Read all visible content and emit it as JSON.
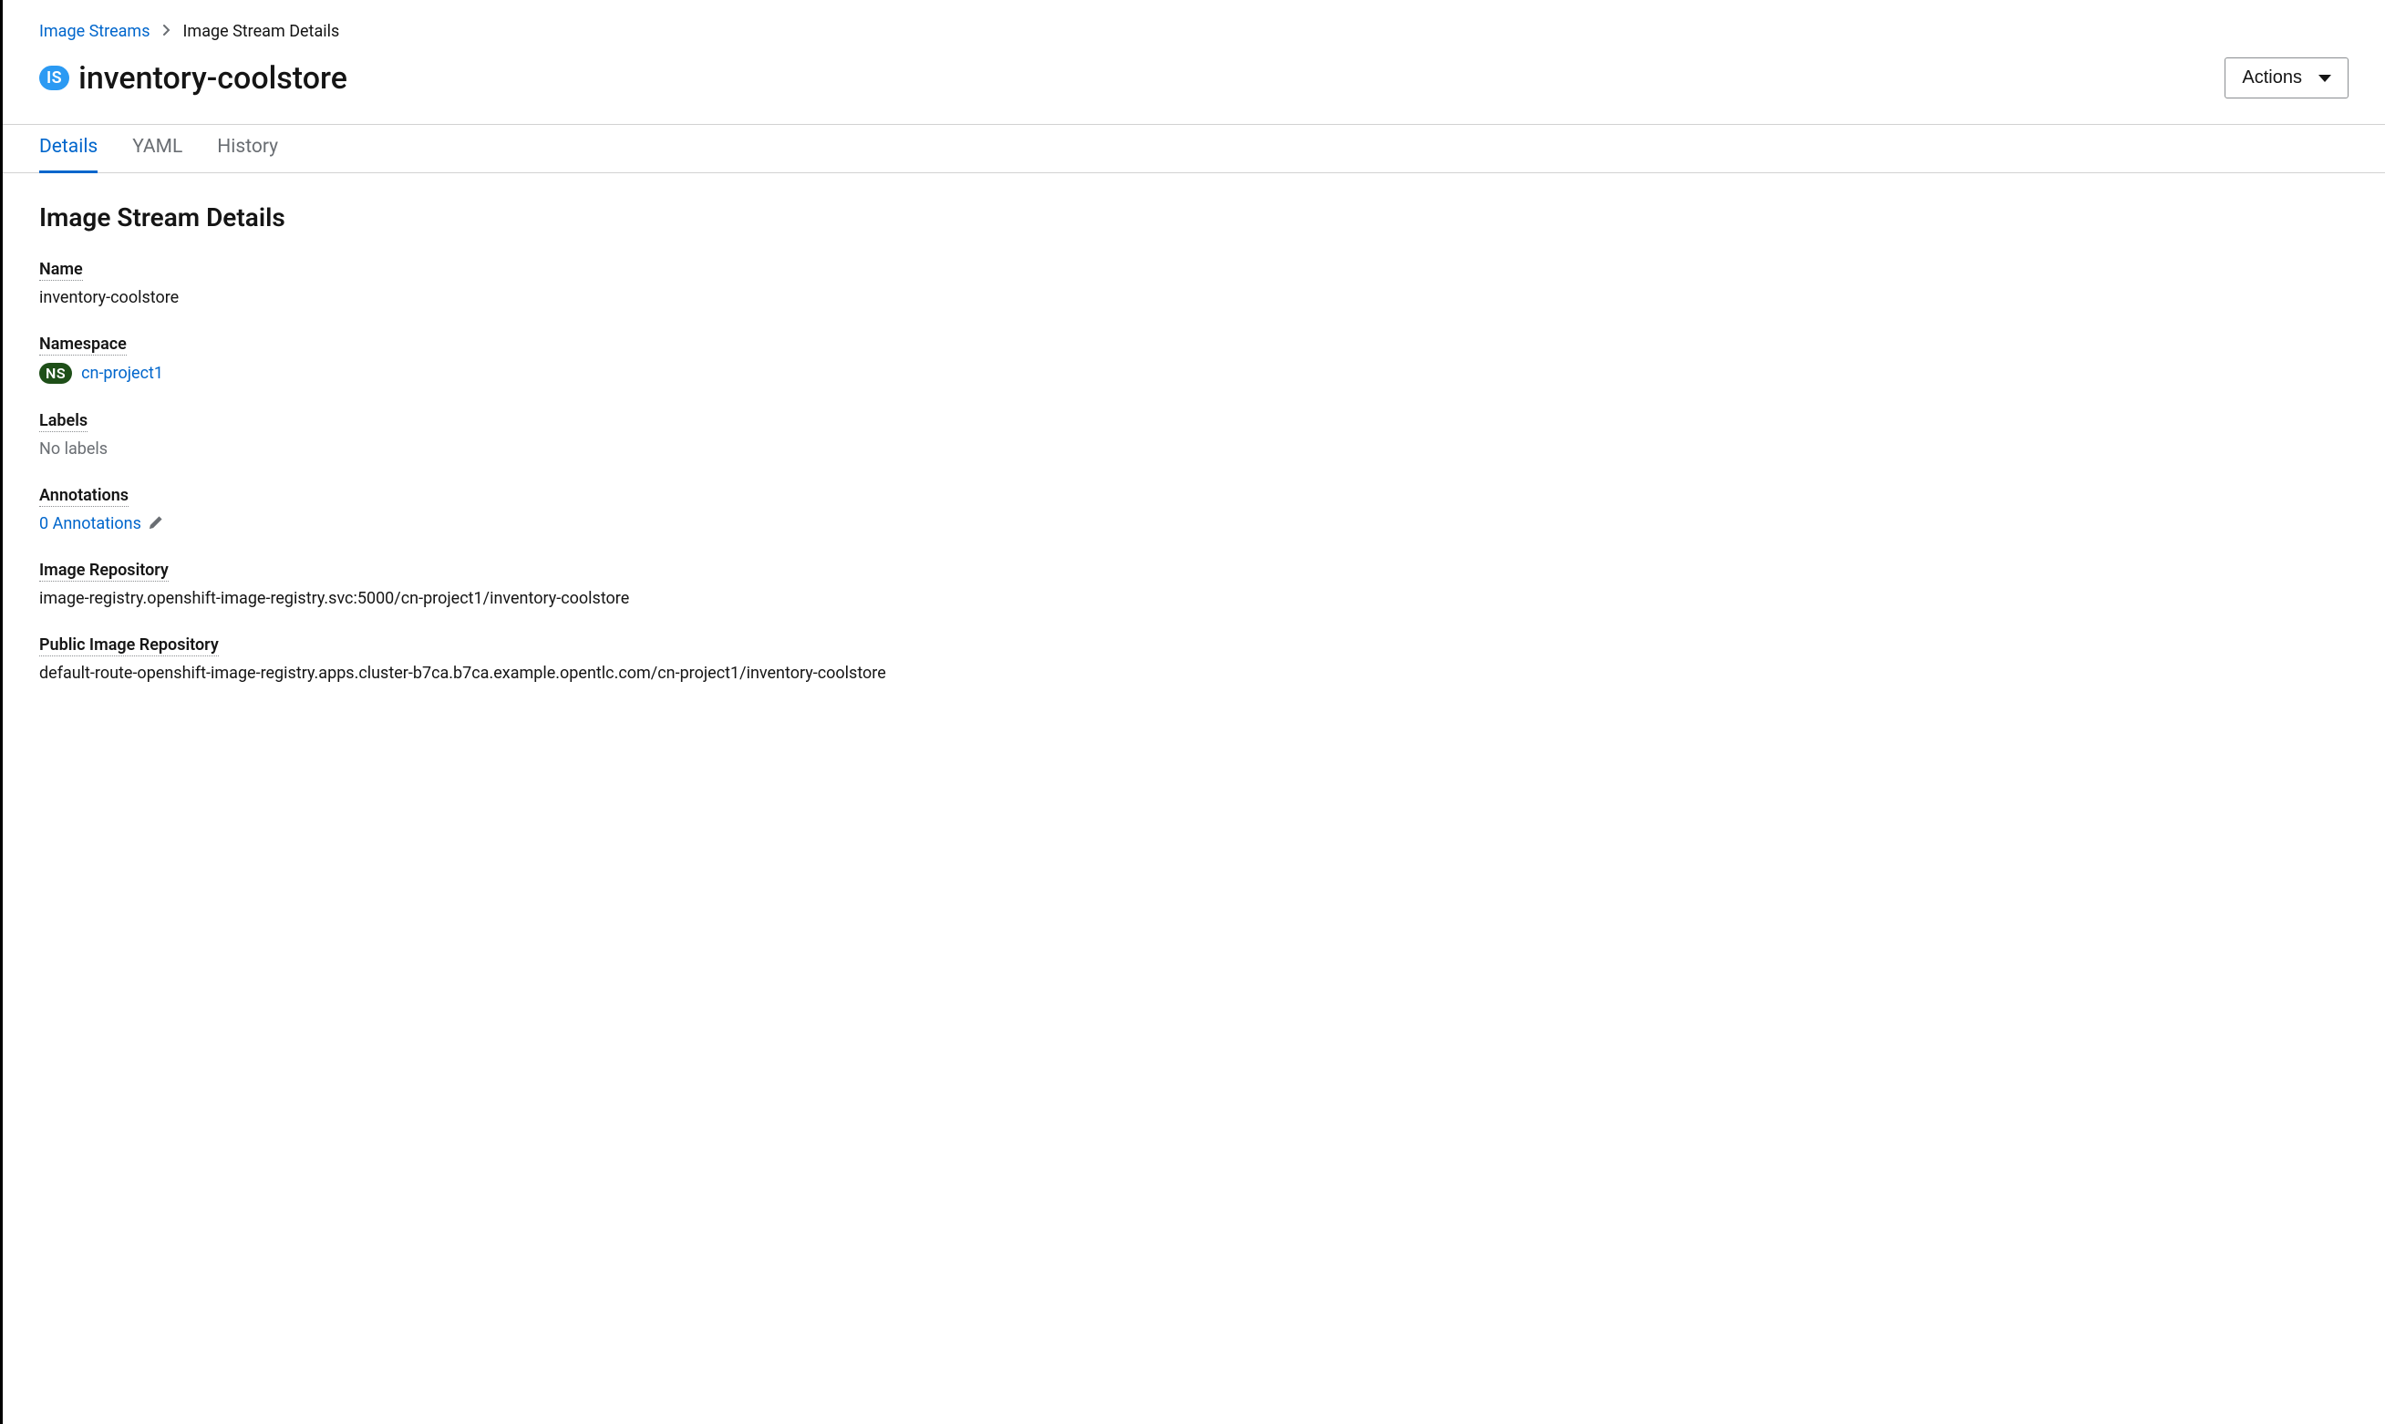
{
  "breadcrumb": {
    "parent": "Image Streams",
    "current": "Image Stream Details"
  },
  "header": {
    "badge": "IS",
    "title": "inventory-coolstore",
    "actions_label": "Actions"
  },
  "tabs": [
    {
      "label": "Details",
      "active": true
    },
    {
      "label": "YAML",
      "active": false
    },
    {
      "label": "History",
      "active": false
    }
  ],
  "section": {
    "title": "Image Stream Details"
  },
  "details": {
    "name_label": "Name",
    "name_value": "inventory-coolstore",
    "namespace_label": "Namespace",
    "namespace_badge": "NS",
    "namespace_value": "cn-project1",
    "labels_label": "Labels",
    "labels_value": "No labels",
    "annotations_label": "Annotations",
    "annotations_value": "0 Annotations",
    "image_repo_label": "Image Repository",
    "image_repo_value": "image-registry.openshift-image-registry.svc:5000/cn-project1/inventory-coolstore",
    "public_image_repo_label": "Public Image Repository",
    "public_image_repo_value": "default-route-openshift-image-registry.apps.cluster-b7ca.b7ca.example.opentlc.com/cn-project1/inventory-coolstore"
  }
}
